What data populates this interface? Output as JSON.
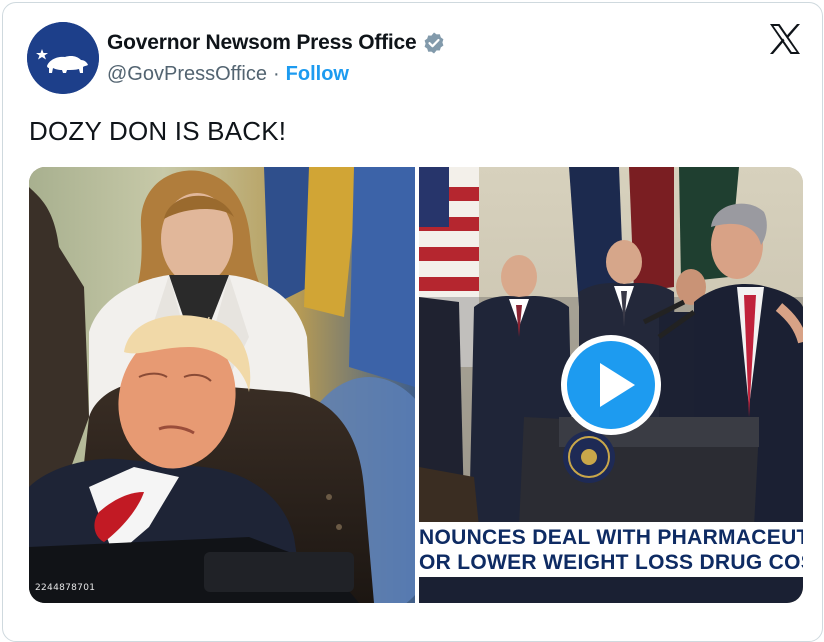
{
  "author": {
    "display_name": "Governor Newsom Press Office",
    "handle": "@GovPressOffice",
    "separator": "·",
    "follow_label": "Follow",
    "verified_color": "#829aab",
    "avatar_icon": "california-bear-icon"
  },
  "platform": {
    "logo_icon": "x-logo-icon"
  },
  "tweet": {
    "text": "DOZY DON IS BACK!"
  },
  "media": {
    "left": {
      "type": "photo",
      "photo_id": "2244878701"
    },
    "right": {
      "type": "video",
      "play_icon": "play-icon",
      "chyron_line1": "NOUNCES DEAL WITH PHARMACEUTICAL",
      "chyron_line2": "OR LOWER WEIGHT LOSS DRUG COSTS"
    }
  },
  "colors": {
    "accent": "#1d9bf0",
    "text_primary": "#0f1419",
    "text_secondary": "#536471",
    "border": "#cfd9de",
    "chyron_text": "#0e2b63"
  }
}
